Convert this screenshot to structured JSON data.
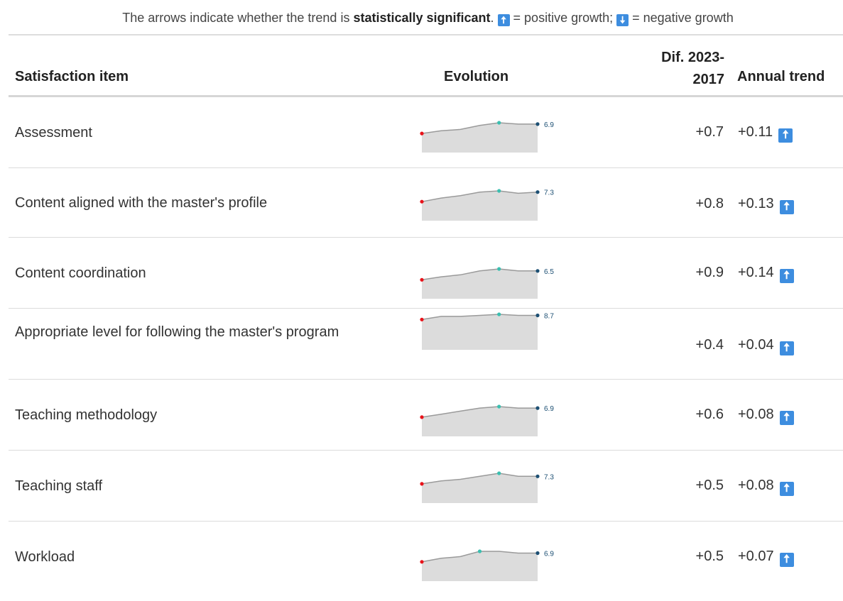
{
  "legend": {
    "prefix": "The arrows indicate whether the trend is ",
    "bold": "statistically significant",
    "after_bold": ". ",
    "up_meaning": " = positive growth; ",
    "down_meaning": " = negative growth",
    "up_symbol": "🠅",
    "down_symbol": "🠇"
  },
  "headers": {
    "item": "Satisfaction item",
    "evolution": "Evolution",
    "dif_line1": "Dif. 2023-",
    "dif_line2": "2017",
    "trend": "Annual trend"
  },
  "colors": {
    "arrow": "#3d8ddf",
    "spark_fill": "#dcdcdc",
    "spark_line": "#9a9a9a",
    "first_point": "#e8141b",
    "max_point": "#3bbfb0",
    "last_point": "#1c4f73"
  },
  "rows": [
    {
      "label": "Assessment",
      "last_value": "6.9",
      "dif": "+0.7",
      "trend": "+0.11",
      "arrow": "up",
      "series": [
        6.2,
        6.4,
        6.5,
        6.8,
        7.0,
        6.9,
        6.9
      ]
    },
    {
      "label": "Content aligned with the master's profile",
      "last_value": "7.3",
      "dif": "+0.8",
      "trend": "+0.13",
      "arrow": "up",
      "series": [
        6.5,
        6.8,
        7.0,
        7.3,
        7.4,
        7.2,
        7.3
      ]
    },
    {
      "label": "Content coordination",
      "last_value": "6.5",
      "dif": "+0.9",
      "trend": "+0.14",
      "arrow": "up",
      "series": [
        5.6,
        5.9,
        6.1,
        6.5,
        6.7,
        6.5,
        6.5
      ]
    },
    {
      "label": "Appropriate level for following the master's program",
      "last_value": "8.7",
      "dif": "+0.4",
      "trend": "+0.04",
      "arrow": "up",
      "series": [
        8.3,
        8.6,
        8.6,
        8.7,
        8.8,
        8.7,
        8.7
      ]
    },
    {
      "label": "Teaching methodology",
      "last_value": "6.9",
      "dif": "+0.6",
      "trend": "+0.08",
      "arrow": "up",
      "series": [
        6.3,
        6.5,
        6.7,
        6.9,
        7.0,
        6.9,
        6.9
      ]
    },
    {
      "label": "Teaching staff",
      "last_value": "7.3",
      "dif": "+0.5",
      "trend": "+0.08",
      "arrow": "up",
      "series": [
        6.8,
        7.0,
        7.1,
        7.3,
        7.5,
        7.3,
        7.3
      ]
    },
    {
      "label": "Workload",
      "last_value": "6.9",
      "dif": "+0.5",
      "trend": "+0.07",
      "arrow": "up",
      "series": [
        6.4,
        6.6,
        6.7,
        7.0,
        7.0,
        6.9,
        6.9
      ]
    }
  ]
}
